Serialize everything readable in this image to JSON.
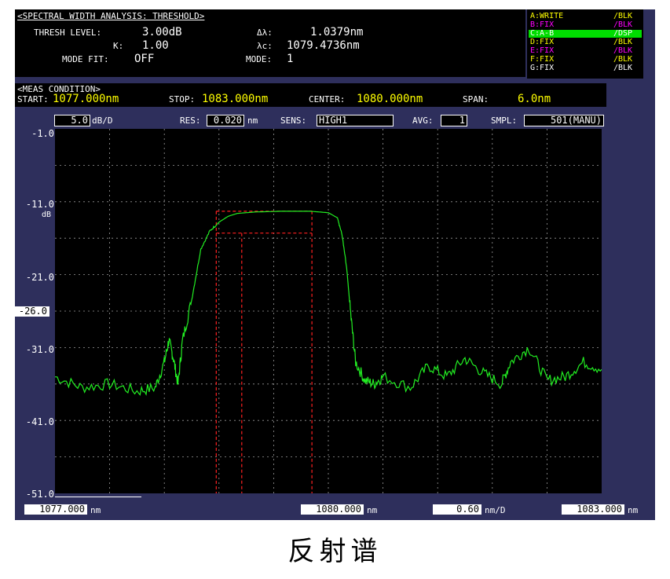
{
  "analysis": {
    "title": "<SPECTRAL WIDTH ANALYSIS: THRESHOLD>",
    "thresh_label": "THRESH LEVEL:",
    "thresh_value": "3.00dB",
    "k_label": "K:",
    "k_value": "1.00",
    "mode_fit_label": "MODE FIT:",
    "mode_fit_value": "OFF",
    "dl_label": "Δλ:",
    "dl_value": "1.0379nm",
    "lc_label": "λc:",
    "lc_value": "1079.4736nm",
    "mode_label": "MODE:",
    "mode_value": "1"
  },
  "traces": [
    {
      "name": "A:WRITE",
      "state": "/BLK",
      "color": "#ffff00",
      "highlight": false
    },
    {
      "name": "B:FIX",
      "state": "/BLK",
      "color": "#ff00ff",
      "highlight": false
    },
    {
      "name": "C:A-B",
      "state": "/DSP",
      "color": "#ffffff",
      "highlight": true
    },
    {
      "name": "D:FIX",
      "state": "/BLK",
      "color": "#ffff00",
      "highlight": false
    },
    {
      "name": "E:FIX",
      "state": "/BLK",
      "color": "#ff00ff",
      "highlight": false
    },
    {
      "name": "F:FIX",
      "state": "/BLK",
      "color": "#ffff00",
      "highlight": false
    },
    {
      "name": "G:FIX",
      "state": "/BLK",
      "color": "#ffffff",
      "highlight": false
    }
  ],
  "meas": {
    "title": "<MEAS CONDITION>",
    "start_label": "START:",
    "start_value": "1077.000nm",
    "stop_label": "STOP:",
    "stop_value": "1083.000nm",
    "center_label": "CENTER:",
    "center_value": "1080.000nm",
    "span_label": "SPAN:",
    "span_value": "6.0nm"
  },
  "settings": {
    "scale_value": "5.0",
    "scale_unit": "dB/D",
    "res_label": "RES:",
    "res_value": "0.020",
    "res_unit": "nm",
    "sens_label": "SENS:",
    "sens_value": "HIGH1",
    "avg_label": "AVG:",
    "avg_value": "1",
    "smpl_label": "SMPL:",
    "smpl_value": "501(MANU)"
  },
  "y_axis": {
    "labels": [
      "-1.0",
      "-11.0",
      "-21.0",
      "-31.0",
      "-41.0",
      "-51.0"
    ],
    "unit": "dB",
    "ref_value": "-26.0"
  },
  "x_axis": {
    "start": "1077.000",
    "center": "1080.000",
    "stop": "1083.000",
    "unit": "nm",
    "per_div": "0.60",
    "per_div_unit": "nm/D"
  },
  "caption": "反射谱",
  "colors": {
    "trace": "#22ee22",
    "marker": "#ff2020",
    "grid": "#9a9a9a",
    "frame": "#2e2f5c",
    "highlight": "#00dd00"
  },
  "chart_data": {
    "type": "line",
    "x_unit": "nm",
    "y_unit": "dB",
    "xlim": [
      1077.0,
      1083.0
    ],
    "ylim": [
      -51.0,
      -1.0
    ],
    "grid": true,
    "series": [
      {
        "x": [
          1077.0,
          1077.3,
          1077.6,
          1077.9,
          1078.1,
          1078.2,
          1078.25,
          1078.3,
          1078.35,
          1078.4,
          1078.5,
          1078.6,
          1078.7,
          1078.8,
          1078.9,
          1079.0,
          1079.2,
          1079.5,
          1079.8,
          1080.0,
          1080.1,
          1080.15,
          1080.2,
          1080.25,
          1080.3,
          1080.4,
          1080.5,
          1080.6,
          1080.9,
          1081.1,
          1081.3,
          1081.5,
          1081.7,
          1081.9,
          1082.0,
          1082.2,
          1082.4,
          1082.6,
          1082.8,
          1083.0
        ],
        "y": [
          -35.0,
          -36.5,
          -36.0,
          -37.0,
          -36.5,
          -33.0,
          -30.0,
          -32.5,
          -36.0,
          -30.0,
          -24.5,
          -17.5,
          -15.0,
          -13.8,
          -13.0,
          -12.6,
          -12.4,
          -12.3,
          -12.3,
          -12.5,
          -13.2,
          -15.5,
          -20.0,
          -27.0,
          -33.0,
          -35.5,
          -36.0,
          -35.0,
          -36.5,
          -33.5,
          -35.0,
          -32.5,
          -34.5,
          -36.0,
          -33.0,
          -31.0,
          -35.5,
          -35.0,
          -33.0,
          -34.0
        ]
      }
    ],
    "markers": {
      "threshold_outer_x": [
        1078.77,
        1079.82
      ],
      "threshold_inner_x": [
        1079.05,
        1079.82
      ],
      "top_level": -12.3,
      "threshold_level": -15.3
    }
  }
}
